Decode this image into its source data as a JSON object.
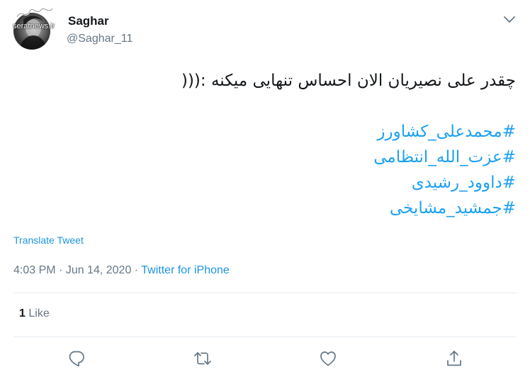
{
  "colors": {
    "text": "#14171a",
    "secondary": "#657786",
    "link": "#1b95e0",
    "hashtag": "#1da1f2",
    "divider": "#e6ecf0"
  },
  "author": {
    "name": "Saghar",
    "handle": "@Saghar_11",
    "avatar_watermark": "seratnews.ir"
  },
  "tweet": {
    "text": "چقدر علی نصیریان الان احساس تنهایی میکنه :(((",
    "hashtags": [
      "#محمدعلی_کشاورز",
      "#عزت_الله_انتظامی",
      "#داوود_رشیدی",
      "#جمشید_مشایخی"
    ],
    "translate_label": "Translate Tweet",
    "time": "4:03 PM",
    "separator": " · ",
    "date": "Jun 14, 2020",
    "source": "Twitter for iPhone"
  },
  "stats": {
    "likes_count": "1",
    "likes_label": "Like"
  },
  "icons": {
    "caret": "chevron-down-icon",
    "reply": "reply-icon",
    "retweet": "retweet-icon",
    "like": "heart-icon",
    "share": "share-icon"
  }
}
